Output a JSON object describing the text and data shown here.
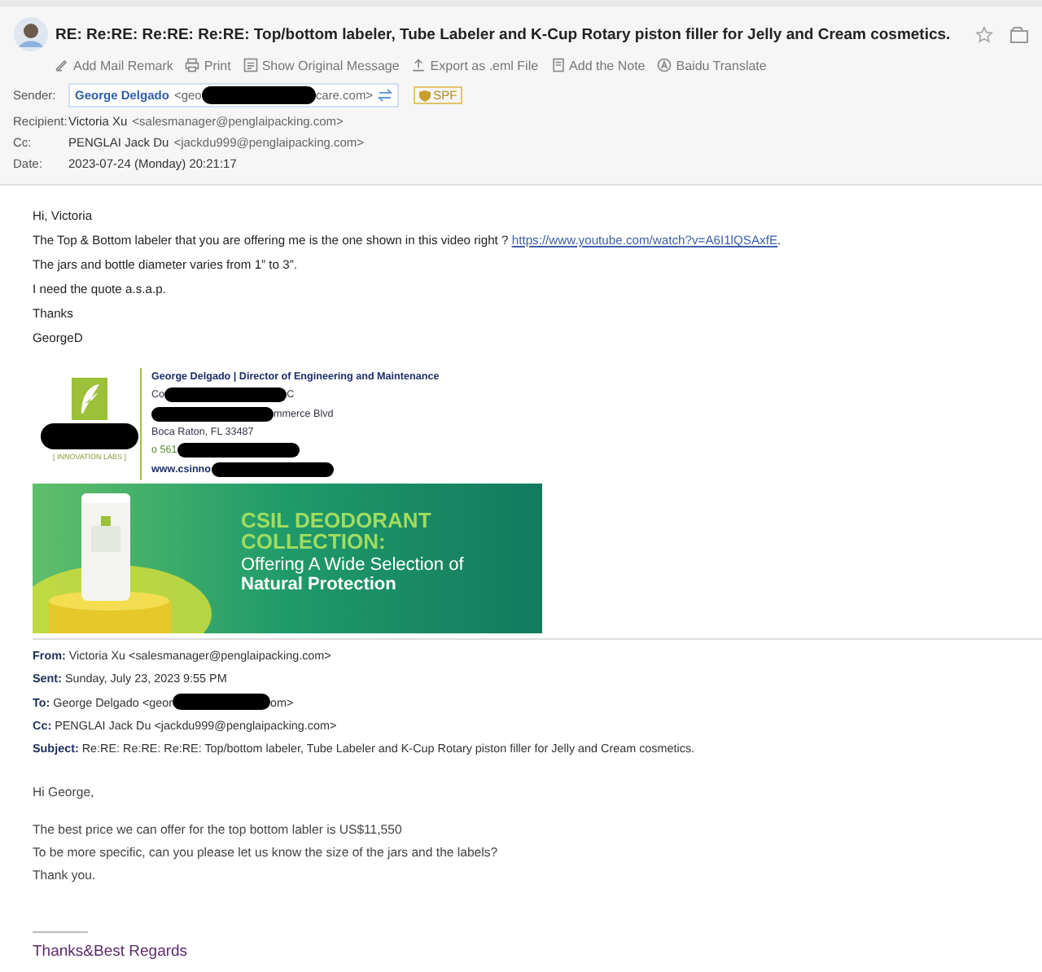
{
  "header": {
    "subject": "RE: Re:RE: Re:RE: Re:RE: Top/bottom labeler, Tube Labeler and K-Cup Rotary piston filler for Jelly and Cream cosmetics.",
    "toolbar": [
      {
        "label": "Add Mail Remark",
        "kind": "pen"
      },
      {
        "label": "Print",
        "kind": "print"
      },
      {
        "label": "Show Original Message",
        "kind": "doc"
      },
      {
        "label": "Export as .eml File",
        "kind": "export"
      },
      {
        "label": "Add the Note",
        "kind": "note"
      },
      {
        "label": "Baidu Translate",
        "kind": "translate"
      }
    ]
  },
  "meta": [
    {
      "label": "Sender:",
      "kind": "sender",
      "name": "George Delgado",
      "segments": [
        {
          "kind": "text",
          "text": "<geo"
        },
        {
          "kind": "redaction"
        },
        {
          "kind": "text",
          "text": "care.com>"
        }
      ],
      "badge": "SPF"
    },
    {
      "label": "Recipient:",
      "kind": "plain",
      "name": "Victoria Xu",
      "segments": [
        {
          "kind": "text",
          "text": "<salesmanager@penglaipacking.com>"
        }
      ]
    },
    {
      "label": "Cc:",
      "kind": "plain",
      "name": "PENGLAI Jack Du",
      "segments": [
        {
          "kind": "text",
          "text": "<jackdu999@penglaipacking.com>"
        }
      ]
    },
    {
      "label": "Date:",
      "kind": "plain",
      "name": "2023-07-24 (Monday) 20:21:17"
    }
  ],
  "body": [
    {
      "text": "Hi, Victoria"
    },
    {
      "text": "The Top & Bottom labeler that you are offering me is the one shown in this video right ?",
      "link": "https://www.youtube.com/watch?v=A6I1lQSAxfE",
      "after": "."
    },
    {
      "text": "The jars and bottle diameter varies from 1” to 3”."
    },
    {
      "text": "I need the quote a.s.a.p."
    },
    {
      "text": "Thanks"
    },
    {
      "text": "GeorgeD"
    }
  ],
  "signature": {
    "logo_tagline": "[ INNOVATION LABS ]",
    "name_title": "George Delgado | Director of Engineering and Maintenance",
    "lines": [
      {
        "kind": "company",
        "segments": [
          {
            "kind": "text",
            "text": "Co"
          },
          {
            "kind": "redaction"
          },
          {
            "kind": "text",
            "text": "C"
          }
        ]
      },
      {
        "kind": "address",
        "segments": [
          {
            "kind": "redaction"
          },
          {
            "kind": "text",
            "text": "mmerce Blvd"
          }
        ]
      },
      {
        "kind": "address",
        "segments": [
          {
            "kind": "text",
            "text": "Boca Raton, FL 33487"
          }
        ]
      },
      {
        "kind": "phone",
        "segments": [
          {
            "kind": "text",
            "text": "o 561"
          },
          {
            "kind": "redaction"
          }
        ]
      },
      {
        "kind": "web",
        "segments": [
          {
            "kind": "text",
            "text": "www.csinno"
          },
          {
            "kind": "redaction"
          }
        ]
      }
    ],
    "banner": {
      "headline": "CSIL DEODORANT COLLECTION:",
      "subline": "Offering A Wide Selection of",
      "emphasis": "Natural Protection"
    }
  },
  "quoted_header": [
    {
      "label": "From:",
      "segments": [
        {
          "kind": "text",
          "text": "Victoria Xu <salesmanager@penglaipacking.com>"
        }
      ]
    },
    {
      "label": "Sent:",
      "segments": [
        {
          "kind": "text",
          "text": "Sunday, July 23, 2023 9:55 PM"
        }
      ]
    },
    {
      "label": "To:",
      "segments": [
        {
          "kind": "text",
          "text": "George Delgado <geor"
        },
        {
          "kind": "redaction"
        },
        {
          "kind": "text",
          "text": "om>"
        }
      ]
    },
    {
      "label": "Cc:",
      "segments": [
        {
          "kind": "text",
          "text": "PENGLAI Jack Du <jackdu999@penglaipacking.com>"
        }
      ]
    },
    {
      "label": "Subject:",
      "segments": [
        {
          "kind": "text",
          "text": "Re:RE: Re:RE: Re:RE: Top/bottom labeler, Tube Labeler and K-Cup Rotary piston filler for Jelly and Cream cosmetics."
        }
      ]
    }
  ],
  "reply": {
    "greeting": "Hi George,",
    "lines": [
      "The best price we can offer for the top bottom labler is US$11,550",
      "To be more specific, can you please let us know the size of the jars and the labels?",
      "Thank you."
    ],
    "closing": "Thanks&Best Regards"
  }
}
